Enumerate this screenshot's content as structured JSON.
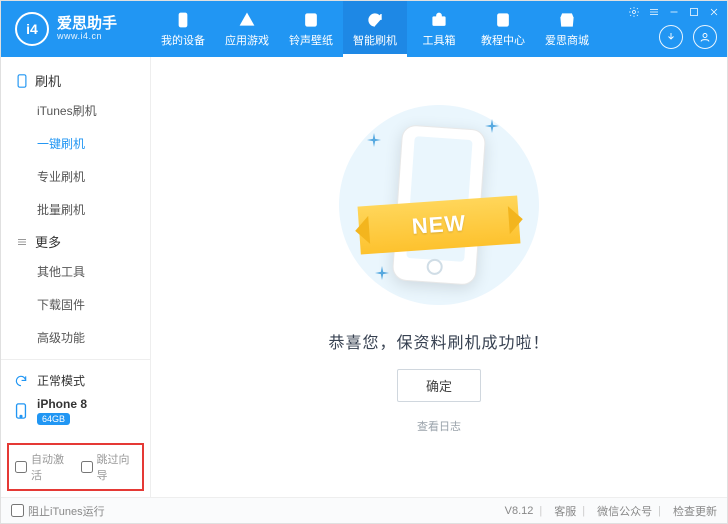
{
  "brand": {
    "title": "爱思助手",
    "subtitle": "www.i4.cn",
    "logo_text": "i4"
  },
  "nav": {
    "items": [
      {
        "label": "我的设备",
        "icon": "phone"
      },
      {
        "label": "应用游戏",
        "icon": "apps"
      },
      {
        "label": "铃声壁纸",
        "icon": "music"
      },
      {
        "label": "智能刷机",
        "icon": "refresh",
        "active": true
      },
      {
        "label": "工具箱",
        "icon": "toolbox"
      },
      {
        "label": "教程中心",
        "icon": "book"
      },
      {
        "label": "爱思商城",
        "icon": "shop"
      }
    ]
  },
  "sidebar": {
    "group1": {
      "label": "刷机"
    },
    "items1": [
      {
        "label": "iTunes刷机"
      },
      {
        "label": "一键刷机",
        "active": true
      },
      {
        "label": "专业刷机"
      },
      {
        "label": "批量刷机"
      }
    ],
    "group2": {
      "label": "更多"
    },
    "items2": [
      {
        "label": "其他工具"
      },
      {
        "label": "下载固件"
      },
      {
        "label": "高级功能"
      }
    ],
    "mode": {
      "label": "正常模式"
    },
    "device": {
      "name": "iPhone 8",
      "badge": "64GB"
    },
    "checks": {
      "auto_activate": "自动激活",
      "skip_guide": "跳过向导"
    }
  },
  "main": {
    "ribbon_text": "NEW",
    "message": "恭喜您，保资料刷机成功啦！",
    "ok": "确定",
    "view_log": "查看日志"
  },
  "footer": {
    "block_itunes": "阻止iTunes运行",
    "version": "V8.12",
    "support": "客服",
    "wechat": "微信公众号",
    "update": "检查更新"
  }
}
